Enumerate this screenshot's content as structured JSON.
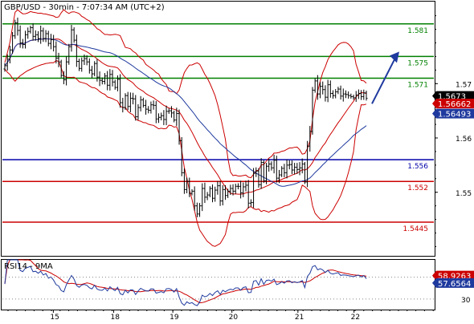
{
  "header": {
    "title": "GBP/USD - 30min - 7:07:34 AM (UTC+2)"
  },
  "colors": {
    "background": "#ffffff",
    "frame": "#000000",
    "resistance": "#008000",
    "support": "#cc0000",
    "pivot": "#0000aa",
    "bollinger": "#cc0000",
    "moving_average": "#1f3a9e",
    "candles": "#000000",
    "forecast_arrow": "#1f3a9e",
    "price_tag": "#000000",
    "sma_tag": "#cc0000",
    "ema_tag": "#1f3a9e"
  },
  "chart_data": [
    {
      "type": "candlestick",
      "title": "GBP/USD - 30min - 7:07:34 AM (UTC+2)",
      "x_tick_labels": [
        "15",
        "18",
        "19",
        "20",
        "21",
        "22"
      ],
      "y_ticks": [
        1.55,
        1.56,
        1.57
      ],
      "ylim": [
        1.5383,
        1.5851
      ],
      "grid": false,
      "horizontal_levels": [
        {
          "value": 1.581,
          "label": "1.581",
          "kind": "resistance",
          "color": "#008000"
        },
        {
          "value": 1.575,
          "label": "1.575",
          "kind": "resistance",
          "color": "#008000"
        },
        {
          "value": 1.571,
          "label": "1.571",
          "kind": "resistance",
          "color": "#008000"
        },
        {
          "value": 1.556,
          "label": "1.556",
          "kind": "pivot",
          "color": "#0000aa"
        },
        {
          "value": 1.552,
          "label": "1.552",
          "kind": "support",
          "color": "#cc0000"
        },
        {
          "value": 1.5445,
          "label": "1.5445",
          "kind": "support",
          "color": "#cc0000"
        }
      ],
      "last_values": [
        {
          "label": "1.5673",
          "value": 1.5673,
          "style": "price"
        },
        {
          "label": "1.56662",
          "value": 1.56662,
          "style": "bollinger-mid"
        },
        {
          "label": "1.56493",
          "value": 1.56493,
          "style": "moving-average"
        }
      ],
      "forecast_arrow": {
        "from": 1.5663,
        "to": 1.5759,
        "direction": "up"
      },
      "closes": [
        1.5733,
        1.5745,
        1.5762,
        1.5788,
        1.5812,
        1.5798,
        1.5775,
        1.5772,
        1.579,
        1.5796,
        1.5803,
        1.5787,
        1.579,
        1.5783,
        1.5797,
        1.5783,
        1.5792,
        1.5774,
        1.5781,
        1.5768,
        1.5747,
        1.574,
        1.5715,
        1.5707,
        1.574,
        1.5768,
        1.5799,
        1.578,
        1.5741,
        1.5728,
        1.5742,
        1.5746,
        1.574,
        1.5725,
        1.5718,
        1.5737,
        1.5712,
        1.5706,
        1.5704,
        1.5714,
        1.5697,
        1.5717,
        1.5703,
        1.5693,
        1.5708,
        1.5665,
        1.5656,
        1.5678,
        1.5658,
        1.5673,
        1.5672,
        1.5639,
        1.5656,
        1.567,
        1.566,
        1.5653,
        1.5651,
        1.5661,
        1.566,
        1.5635,
        1.5638,
        1.5641,
        1.5634,
        1.5649,
        1.565,
        1.5646,
        1.5633,
        1.5645,
        1.5595,
        1.5536,
        1.5505,
        1.552,
        1.5498,
        1.5502,
        1.5475,
        1.546,
        1.5475,
        1.5507,
        1.5491,
        1.5495,
        1.5507,
        1.5489,
        1.5504,
        1.5512,
        1.5484,
        1.5505,
        1.5494,
        1.5502,
        1.5507,
        1.5502,
        1.5511,
        1.5511,
        1.5499,
        1.551,
        1.5513,
        1.548,
        1.5481,
        1.5535,
        1.5539,
        1.5514,
        1.5555,
        1.5521,
        1.5548,
        1.5552,
        1.5545,
        1.5559,
        1.5526,
        1.5532,
        1.5544,
        1.5536,
        1.555,
        1.5551,
        1.5541,
        1.5546,
        1.5542,
        1.5545,
        1.5552,
        1.5519,
        1.5585,
        1.5612,
        1.5688,
        1.5705,
        1.5681,
        1.5695,
        1.5689,
        1.5675,
        1.5698,
        1.5682,
        1.5678,
        1.5685,
        1.569,
        1.5677,
        1.5681,
        1.568,
        1.5678,
        1.5676,
        1.5674,
        1.5679,
        1.5682,
        1.5676,
        1.5683,
        1.5673
      ]
    },
    {
      "type": "line",
      "title": "RSI14 - 9MA",
      "y_ticks": [
        30
      ],
      "ylim": [
        16,
        82
      ],
      "last_values": [
        {
          "label": "58.9263",
          "value": 58.9263,
          "style": "sma"
        },
        {
          "label": "57.6564",
          "value": 57.6564,
          "style": "rsi"
        }
      ]
    }
  ]
}
